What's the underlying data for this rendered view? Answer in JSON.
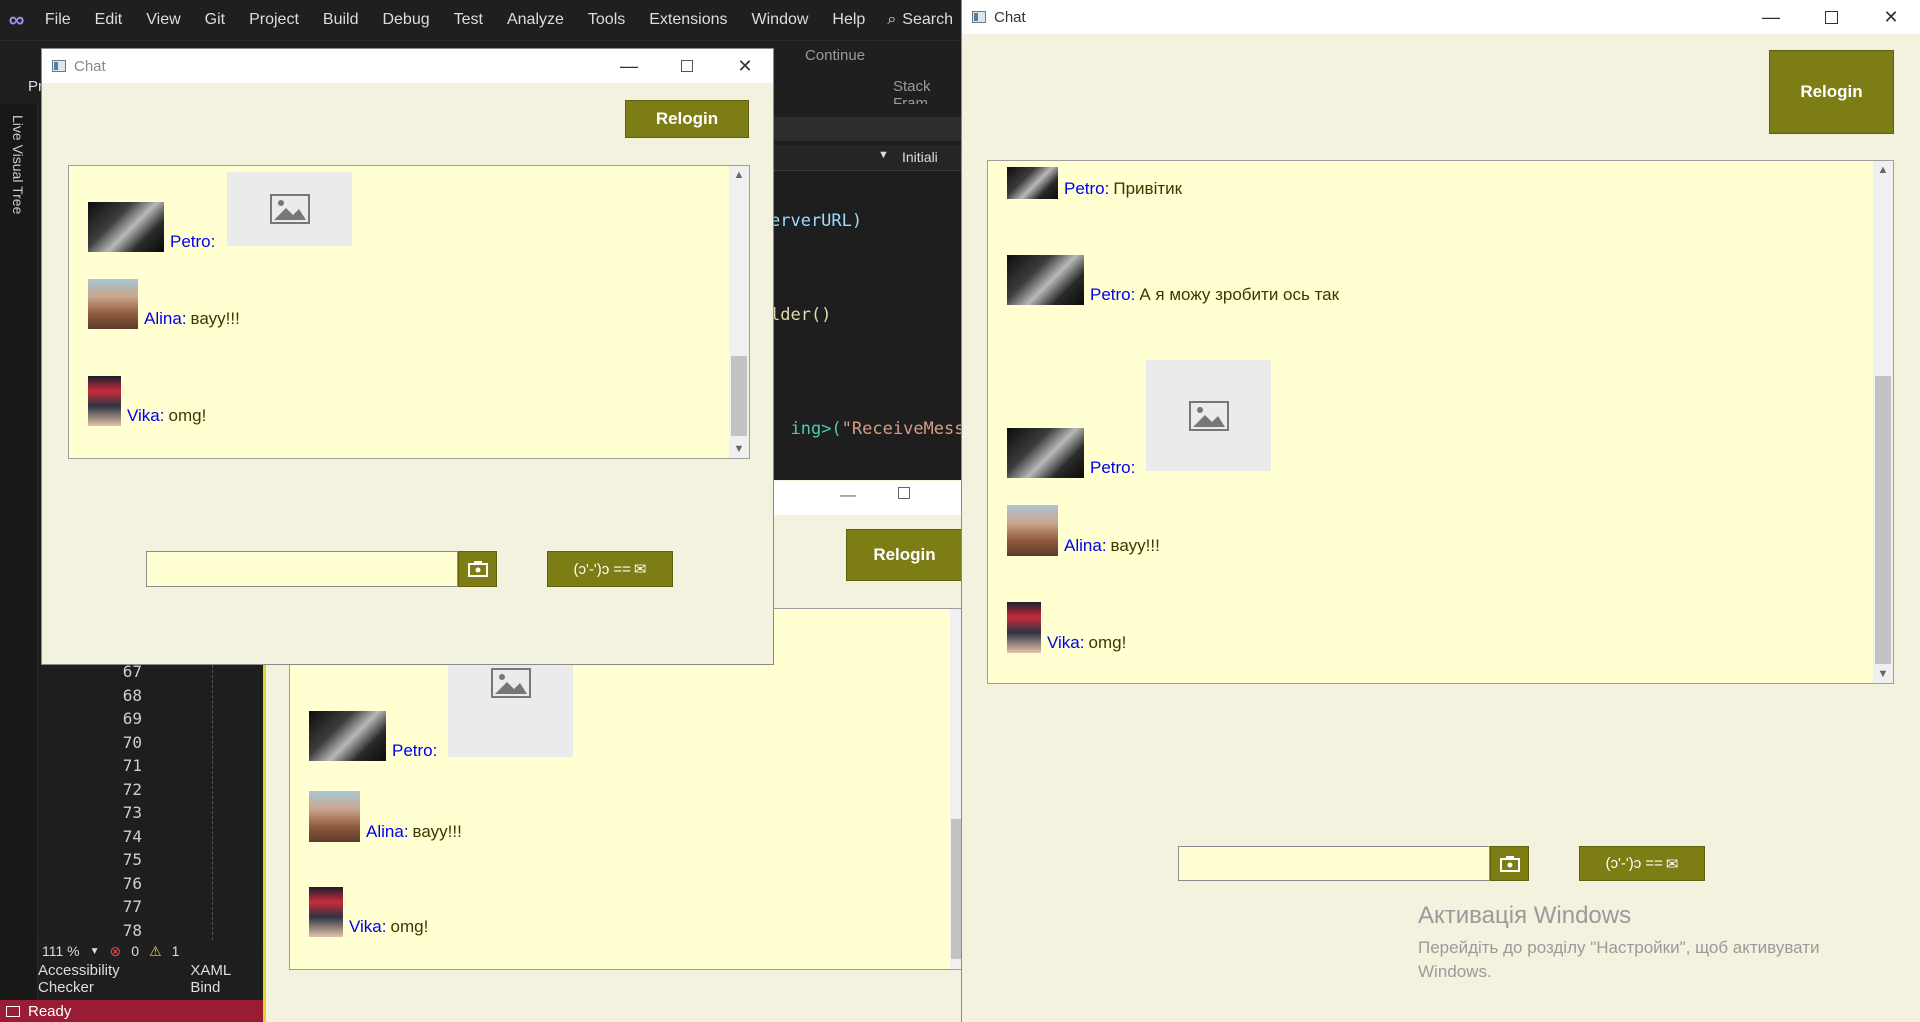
{
  "vs": {
    "menu": [
      "File",
      "Edit",
      "View",
      "Git",
      "Project",
      "Build",
      "Debug",
      "Test",
      "Analyze",
      "Tools",
      "Extensions",
      "Window",
      "Help"
    ],
    "search_label": "Search",
    "toolbar_continue": "Continue",
    "toolbar_stackframe": "Stack Fram",
    "toolbar_pr": "Pr",
    "nav_text": "Initiali",
    "live_visual_tree": "Live Visual Tree",
    "code": {
      "l1": "erverURL)",
      "l2": "lder()",
      "l3_prefix": "ing>(",
      "l3_str": "\"ReceiveMessa"
    },
    "line_numbers": [
      "67",
      "68",
      "69",
      "70",
      "71",
      "72",
      "73",
      "74",
      "75",
      "76",
      "77",
      "78"
    ],
    "zoom": "111 %",
    "errors": "0",
    "warnings": "1",
    "bottom_tabs": [
      "Accessibility Checker",
      "XAML Bind"
    ],
    "status": "Ready"
  },
  "chat_windows": {
    "title": "Chat",
    "relogin": "Relogin",
    "send_label": "(ɔ'-')ɔ ==",
    "users": {
      "petro": "Petro",
      "alina": "Alina",
      "vika": "Vika"
    },
    "messages": {
      "m1": "Привітик",
      "m2": "А я можу зробити ось так",
      "alina": "вауу!!!",
      "vika": "omg!"
    },
    "input_value": ""
  },
  "activation": {
    "title": "Активація Windows",
    "subtitle": "Перейдіть до розділу \"Настройки\", щоб активувати Windows."
  }
}
